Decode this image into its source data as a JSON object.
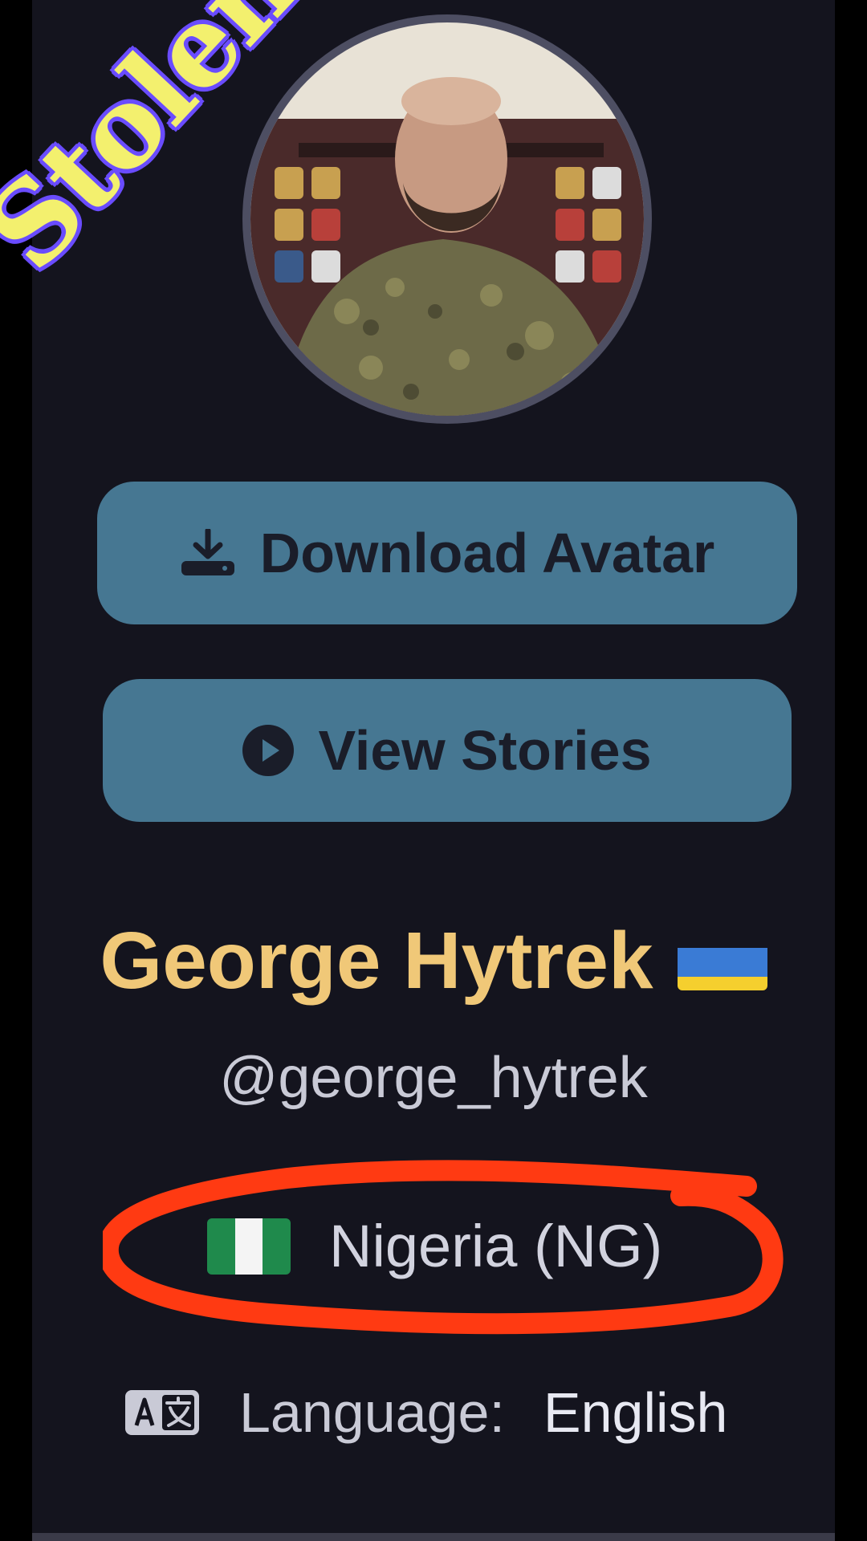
{
  "overlay": {
    "stamp_text": "Stolen",
    "stamp_colors": {
      "fill": "#f3f06e",
      "outline": "#6a4cff"
    },
    "highlight_color": "#ff3a12"
  },
  "profile": {
    "avatar_icon": "avatar-photo",
    "display_name": "George Hytrek",
    "name_flag": "ukraine-flag",
    "handle": "@george_hytrek",
    "country_flag": "nigeria-flag",
    "country": "Nigeria (NG)",
    "language_icon": "translate-icon",
    "language_label": "Language:",
    "language_value": "English"
  },
  "actions": {
    "download_label": "Download Avatar",
    "download_icon": "download-icon",
    "stories_label": "View Stories",
    "stories_icon": "play-circle-icon"
  },
  "colors": {
    "background": "#14141e",
    "button": "#467792",
    "name": "#f0c878",
    "muted_text": "#c9cad6"
  }
}
